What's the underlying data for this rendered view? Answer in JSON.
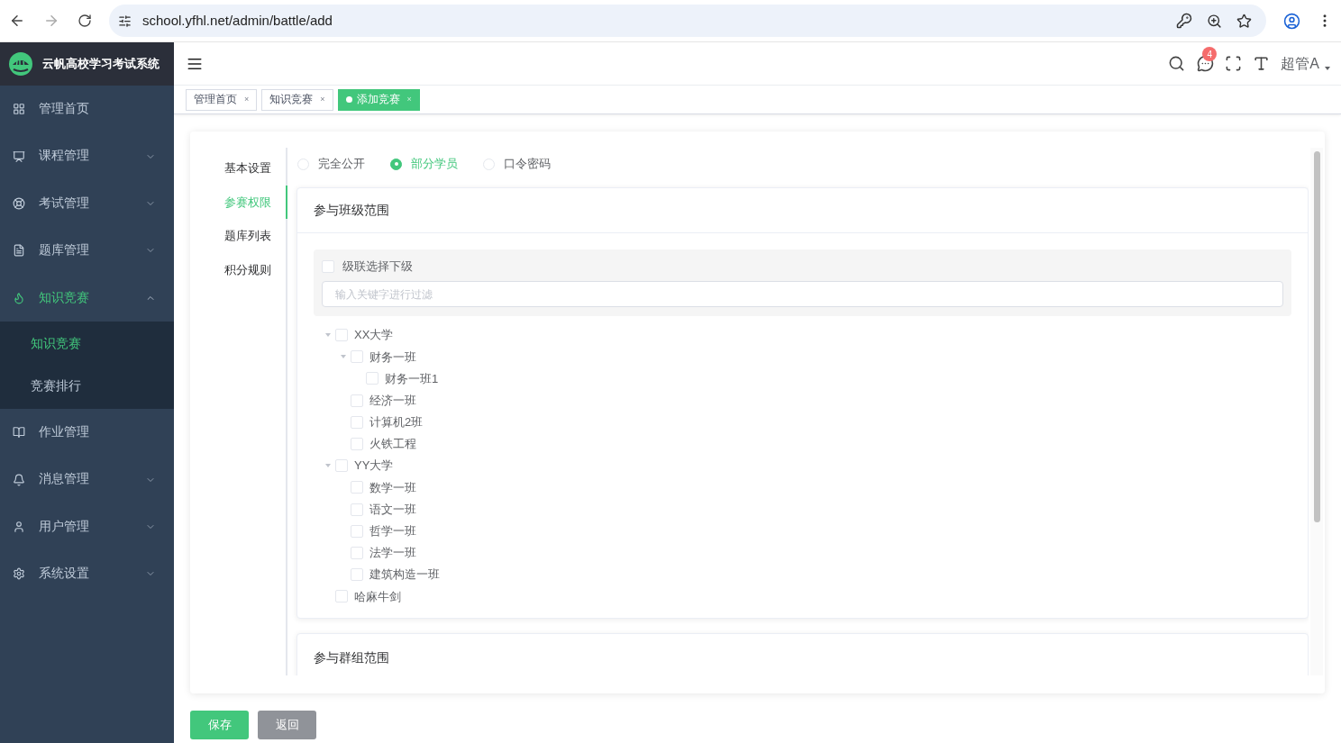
{
  "browser": {
    "url": "school.yfhl.net/admin/battle/add"
  },
  "sidebar": {
    "title": "云帆高校学习考试系统",
    "items": [
      {
        "label": "管理首页",
        "kind": "link",
        "selected": false
      },
      {
        "label": "课程管理",
        "kind": "group",
        "expanded": false,
        "selected": false
      },
      {
        "label": "考试管理",
        "kind": "group",
        "expanded": false,
        "selected": false
      },
      {
        "label": "题库管理",
        "kind": "group",
        "expanded": false,
        "selected": false
      },
      {
        "label": "知识竞赛",
        "kind": "group",
        "expanded": true,
        "selected": true,
        "children": [
          {
            "label": "知识竞赛",
            "selected": true
          },
          {
            "label": "竞赛排行",
            "selected": false
          }
        ]
      },
      {
        "label": "作业管理",
        "kind": "link",
        "selected": false
      },
      {
        "label": "消息管理",
        "kind": "group",
        "expanded": false,
        "selected": false
      },
      {
        "label": "用户管理",
        "kind": "group",
        "expanded": false,
        "selected": false
      },
      {
        "label": "系统设置",
        "kind": "group",
        "expanded": false,
        "selected": false
      }
    ]
  },
  "header": {
    "badge": "4",
    "user": "超管A"
  },
  "tabs": [
    {
      "label": "管理首页",
      "close": "×",
      "selected": false
    },
    {
      "label": "知识竞赛",
      "close": "×",
      "selected": false
    },
    {
      "label": "添加竞赛",
      "close": "×",
      "selected": true
    }
  ],
  "form_nav": [
    {
      "label": "基本设置",
      "selected": false
    },
    {
      "label": "参赛权限",
      "selected": true
    },
    {
      "label": "题库列表",
      "selected": false
    },
    {
      "label": "积分规则",
      "selected": false
    }
  ],
  "access_options": [
    {
      "label": "完全公开",
      "selected": false
    },
    {
      "label": "部分学员",
      "selected": true
    },
    {
      "label": "口令密码",
      "selected": false
    }
  ],
  "class_scope": {
    "title": "参与班级范围",
    "cascade": {
      "label": "级联选择下级",
      "checked": false
    },
    "filter": {
      "placeholder": "输入关键字进行过滤"
    },
    "tree": [
      {
        "label": "XX大学",
        "checked": false,
        "expanded": true,
        "children": [
          {
            "label": "财务一班",
            "checked": false,
            "expanded": true,
            "children": [
              {
                "label": "财务一班1",
                "checked": false
              }
            ]
          },
          {
            "label": "经济一班",
            "checked": false
          },
          {
            "label": "计算机2班",
            "checked": false
          },
          {
            "label": "火铁工程",
            "checked": false
          }
        ]
      },
      {
        "label": "YY大学",
        "checked": false,
        "expanded": true,
        "children": [
          {
            "label": "数学一班",
            "checked": false
          },
          {
            "label": "语文一班",
            "checked": false
          },
          {
            "label": "哲学一班",
            "checked": false
          },
          {
            "label": "法学一班",
            "checked": false
          },
          {
            "label": "建筑构造一班",
            "checked": false
          }
        ]
      },
      {
        "label": "哈麻牛剑",
        "checked": false
      }
    ]
  },
  "group_scope": {
    "title": "参与群组范围"
  },
  "buttons": [
    {
      "label": "保存",
      "kind": "primary"
    },
    {
      "label": "返回",
      "kind": "secondary"
    }
  ]
}
